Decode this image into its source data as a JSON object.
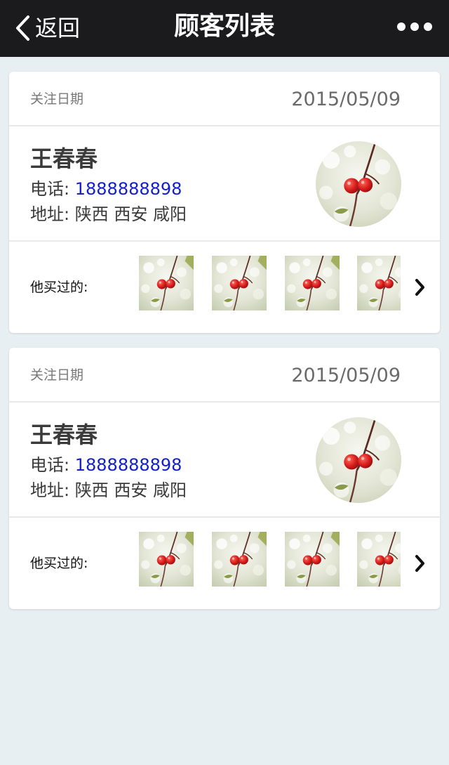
{
  "navbar": {
    "back_label": "返回",
    "title": "顾客列表",
    "more_icon": "more-dots-icon"
  },
  "colors": {
    "navbar_bg": "#1b1b1d",
    "page_bg": "#e8eff2",
    "phone_link": "#1320c8"
  },
  "customers": [
    {
      "follow_label": "关注日期",
      "follow_date": "2015/05/09",
      "name": "王春春",
      "phone_label": "电话:",
      "phone": "1888888898",
      "address_label": "地址:",
      "address": "陕西 西安 咸阳",
      "bought_label": "他买过的:"
    },
    {
      "follow_label": "关注日期",
      "follow_date": "2015/05/09",
      "name": "王春春",
      "phone_label": "电话:",
      "phone": "1888888898",
      "address_label": "地址:",
      "address": "陕西 西安 咸阳",
      "bought_label": "他买过的:"
    }
  ]
}
